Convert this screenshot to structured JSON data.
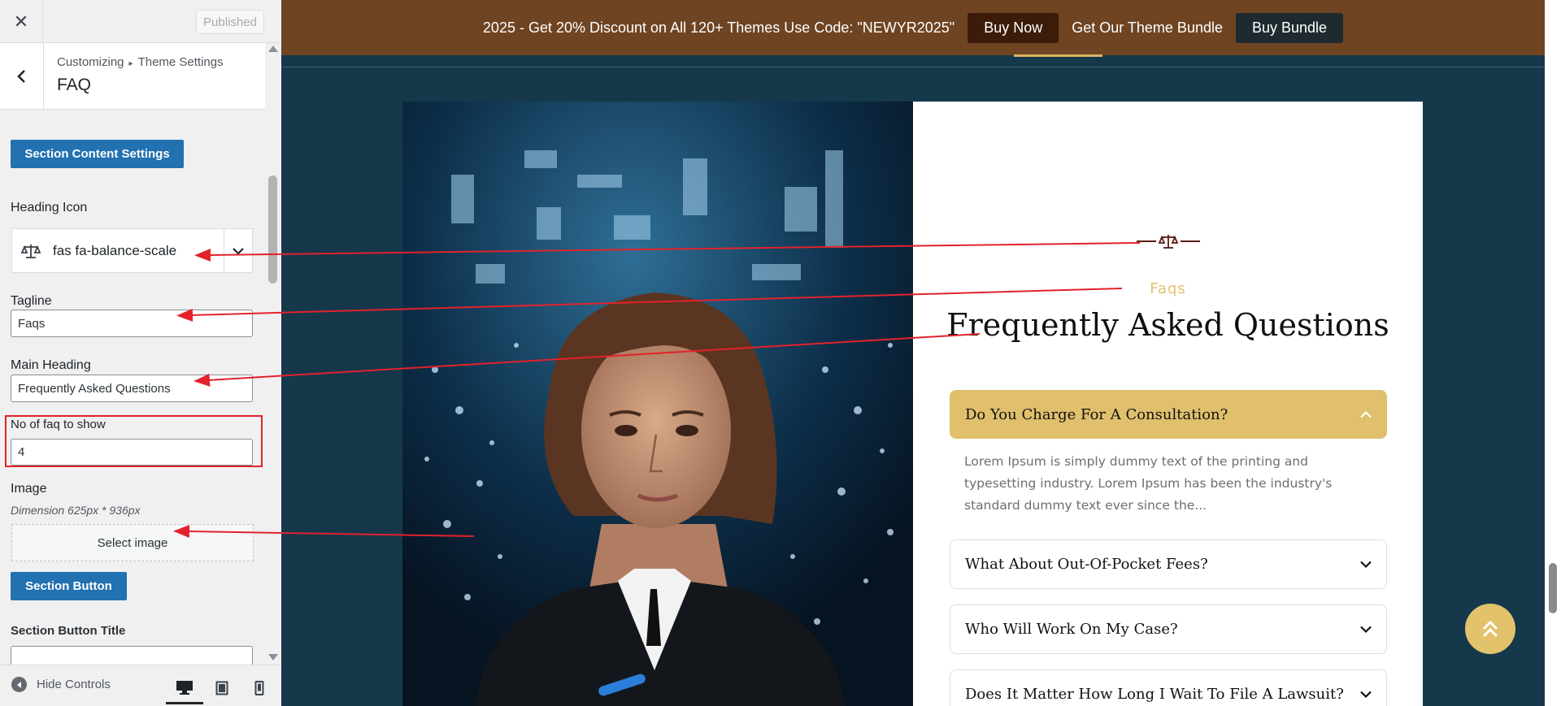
{
  "customizer": {
    "close_icon": "close-icon",
    "published_label": "Published",
    "breadcrumb": {
      "root": "Customizing",
      "separator": "▸",
      "parent": "Theme Settings"
    },
    "section_title": "FAQ",
    "section_content_settings_label": "Section Content Settings",
    "heading_icon_label": "Heading Icon",
    "heading_icon_value": "fas fa-balance-scale",
    "tagline_label": "Tagline",
    "tagline_value": "Faqs",
    "main_heading_label": "Main Heading",
    "main_heading_value": "Frequently Asked Questions",
    "faq_count_label": "No of faq to show",
    "faq_count_value": "4",
    "image_label": "Image",
    "image_dimension_note": "Dimension 625px * 936px",
    "select_image_label": "Select image",
    "section_button_label": "Section Button",
    "section_button_title_label": "Section Button Title",
    "section_button_title_value": "",
    "hide_controls_label": "Hide Controls"
  },
  "promo_bar": {
    "text": "2025 - Get 20% Discount on All 120+ Themes Use Code: \"NEWYR2025\"",
    "buy_now_label": "Buy Now",
    "bundle_text": "Get Our Theme Bundle",
    "buy_bundle_label": "Buy Bundle"
  },
  "faq_section": {
    "icon": "balance-scale-icon",
    "tagline": "Faqs",
    "heading": "Frequently Asked Questions",
    "items": [
      {
        "question": "Do You Charge For A Consultation?",
        "open": true,
        "answer": "Lorem Ipsum is simply dummy text of the printing and typesetting industry. Lorem Ipsum has been the industry's standard dummy text ever since the..."
      },
      {
        "question": "What About Out-Of-Pocket Fees?",
        "open": false
      },
      {
        "question": "Who Will Work On My Case?",
        "open": false
      },
      {
        "question": "Does It Matter How Long I Wait To File A Lawsuit?",
        "open": false
      }
    ]
  },
  "colors": {
    "accent_gold": "#e0c06c",
    "customizer_blue": "#2271b1",
    "annotation_red": "#e3222b",
    "promo_brown": "#6f4422",
    "section_bg": "#15394b"
  }
}
